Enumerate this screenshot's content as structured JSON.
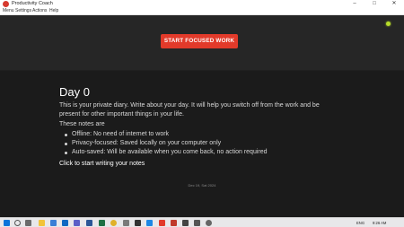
{
  "window": {
    "title": "Productivity Coach",
    "controls": [
      "–",
      "□",
      "✕"
    ]
  },
  "menu": [
    "Menu",
    "Settings",
    "Actions",
    "Help"
  ],
  "header": {
    "focus_button": "START FOCUSED WORK",
    "status_color": "#b7dd2a",
    "accent": "#e23a2a"
  },
  "journal": {
    "title": "Day 0",
    "intro": "This is your private diary. Write about your day. It will help you switch off from the work and be present for other important things in your life.",
    "notes_heading": "These notes are",
    "notes": [
      "Offline: No need of internet to work",
      "Privacy-focused: Saved locally on your computer only",
      "Auto-saved: Will be available when you come back, no action required"
    ],
    "cta": "Click to start writing your notes",
    "date": "Dec 19, Sat 2024"
  },
  "taskbar": {
    "icons": [
      "windows-icon",
      "search-icon",
      "task-view-icon",
      "file-explorer-icon",
      "store-icon",
      "outlook-icon",
      "teams-icon",
      "word-icon",
      "excel-icon",
      "chrome-icon",
      "settings-icon",
      "terminal-icon",
      "vscode-icon",
      "productivity-coach-icon",
      "app-icon",
      "app-icon",
      "app-icon"
    ],
    "language": "ENG",
    "time": "9:26 AM"
  }
}
